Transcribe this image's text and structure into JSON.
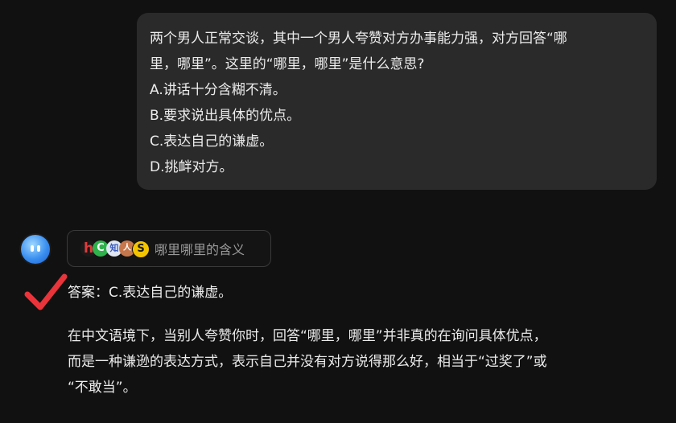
{
  "question": {
    "lines": [
      "两个男人正常交谈，其中一个男人夸赞对方办事能力强，对方回答“哪",
      "里，哪里”。这里的“哪里，哪里”是什么意思?",
      "A.讲话十分含糊不清。",
      "B.要求说出具体的优点。",
      "C.表达自己的谦虚。",
      "D.挑衅对方。"
    ]
  },
  "assistant": {
    "avatar_icon": "blue-blob-avatar-icon",
    "source_chip": {
      "icons": [
        "h-site-icon",
        "c-site-icon",
        "zhihu-style-icon",
        "portrait-icon",
        "s-coin-icon"
      ],
      "favicon_glyphs": [
        "h",
        "C",
        "知",
        "人",
        "S"
      ],
      "label": "哪里哪里的含义"
    },
    "check_icon": "red-checkmark-icon",
    "check_color": "#e8343a",
    "answer": "答案：C.表达自己的谦虚。",
    "explanation_lines": [
      "在中文语境下，当别人夸赞你时，回答“哪里，哪里”并非真的在询问具体优点，",
      "而是一种谦逊的表达方式，表示自己并没有对方说得那么好，相当于“过奖了”或",
      "“不敢当”。"
    ]
  },
  "colors": {
    "background": "#111111",
    "bubble": "#2a2a2a",
    "text": "#ececec",
    "muted": "#9a9a9a"
  }
}
